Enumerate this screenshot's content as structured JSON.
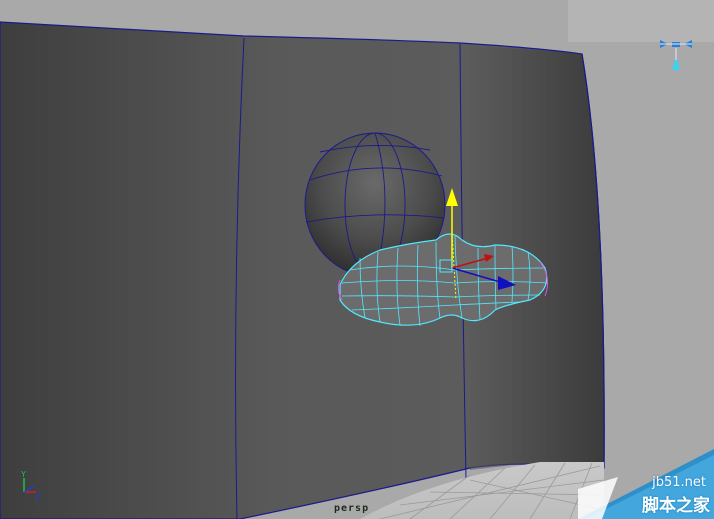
{
  "viewport": {
    "camera_name": "persp",
    "axis_labels": {
      "y": "Y",
      "z": "Z"
    }
  },
  "watermark": {
    "site": "jb51.net",
    "name": "脚本之家"
  },
  "colors": {
    "background": "#a9a9a9",
    "wall": "#585858",
    "wall_edge": "#1a1a8c",
    "wireframe_selected": "#52e8ff",
    "manipulator_y": "#ffff00",
    "manipulator_z": "#1010c0",
    "manipulator_x": "#c01010",
    "vertex_highlight": "#e050e0"
  },
  "icons": [
    "view-cube-icon",
    "axis-gizmo-icon",
    "move-manipulator-icon"
  ]
}
